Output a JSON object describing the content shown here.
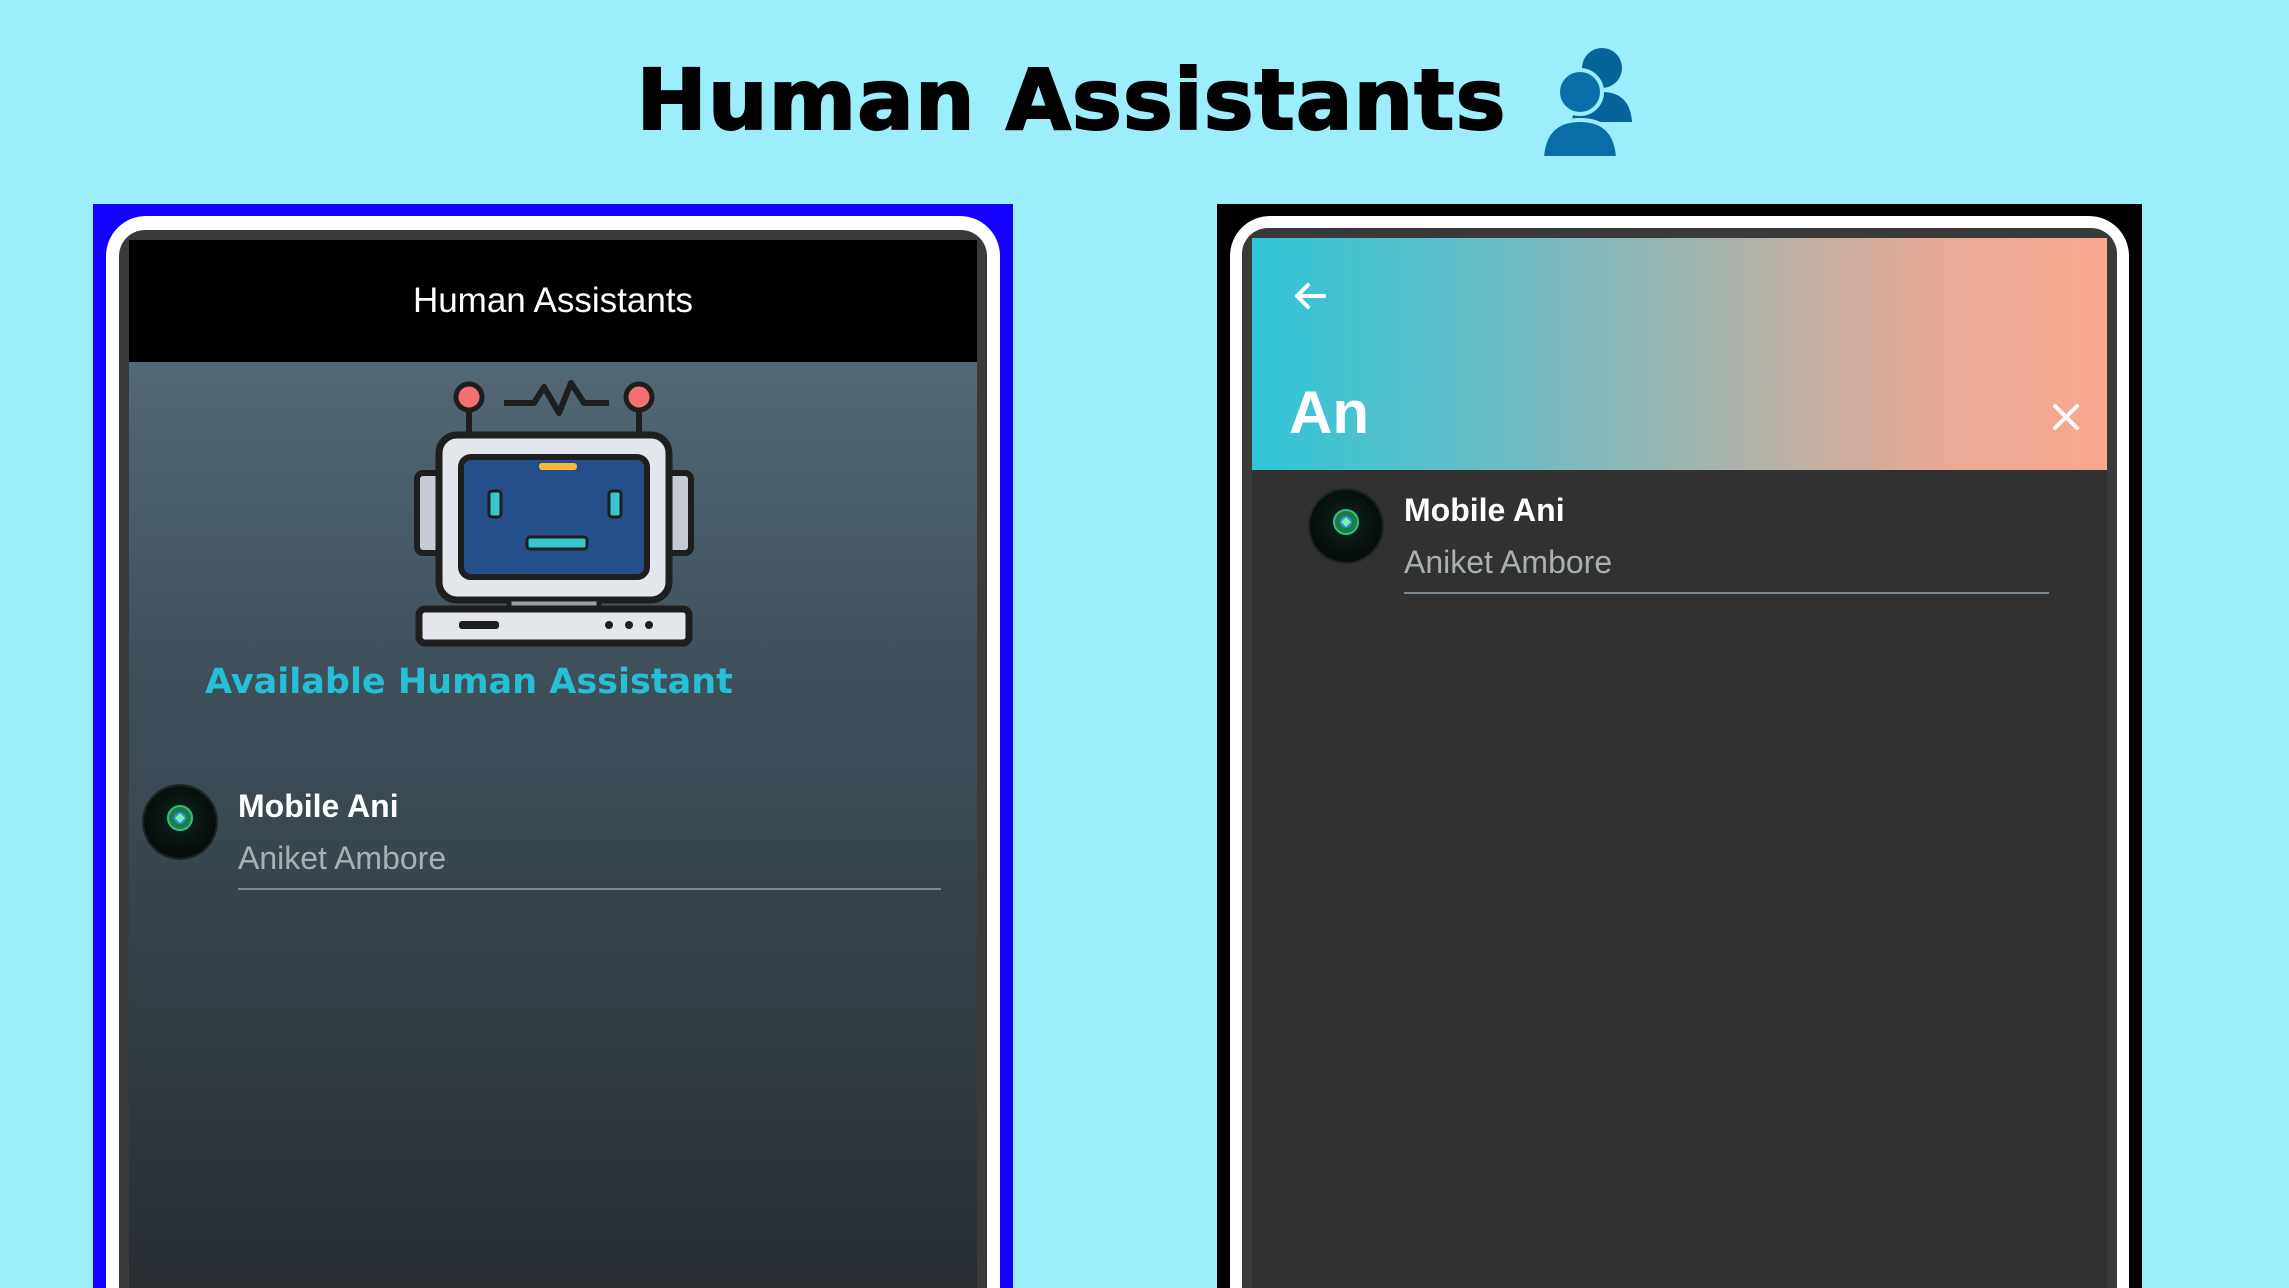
{
  "page": {
    "title": "Human Assistants",
    "title_icon": "users-icon"
  },
  "left_screen": {
    "header_title": "Human Assistants",
    "illustration": "robot-illustration",
    "section_heading": "Available Human Assistant",
    "assistants": [
      {
        "name": "Mobile Ani",
        "subtitle": "Aniket Ambore",
        "avatar": "avatar"
      }
    ]
  },
  "right_screen": {
    "back_icon": "arrow-left-icon",
    "search_query": "An",
    "clear_icon": "close-icon",
    "results": [
      {
        "name": "Mobile Ani",
        "subtitle": "Aniket Ambore",
        "avatar": "avatar"
      }
    ]
  },
  "colors": {
    "page_background": "#9deefc",
    "left_frame": "#1400fe",
    "right_frame": "#000000",
    "section_heading": "#25bfd6",
    "search_gradient_start": "#2fc5d7",
    "search_gradient_end": "#f9a78e"
  }
}
